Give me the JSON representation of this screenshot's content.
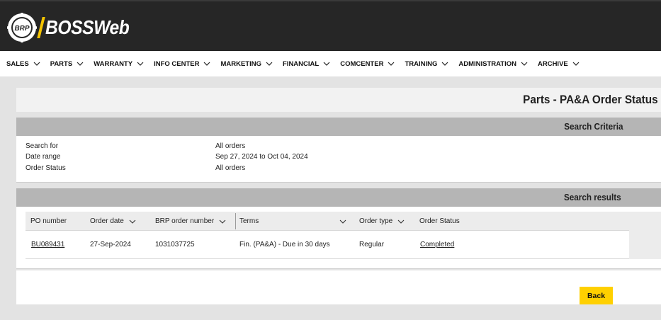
{
  "brand": {
    "brp_logo_text": "BRP",
    "app_name": "BOSSWeb",
    "accent": "#ffd000"
  },
  "nav": {
    "items": [
      {
        "label": "SALES"
      },
      {
        "label": "PARTS"
      },
      {
        "label": "WARRANTY"
      },
      {
        "label": "INFO CENTER"
      },
      {
        "label": "MARKETING"
      },
      {
        "label": "FINANCIAL"
      },
      {
        "label": "COMCENTER"
      },
      {
        "label": "TRAINING"
      },
      {
        "label": "ADMINISTRATION"
      },
      {
        "label": "ARCHIVE"
      }
    ],
    "chevron_icon": "chevron-down-icon"
  },
  "page": {
    "title": "Parts - PA&A Order Status"
  },
  "criteria": {
    "heading": "Search Criteria",
    "rows": [
      {
        "label": "Search for",
        "value": "All orders"
      },
      {
        "label": "Date range",
        "value": "Sep 27, 2024 to Oct 04, 2024"
      },
      {
        "label": "Order Status",
        "value": "All orders"
      }
    ]
  },
  "results": {
    "heading": "Search results",
    "columns": [
      {
        "label": "PO number",
        "sortable": false
      },
      {
        "label": "Order date",
        "sortable": true
      },
      {
        "label": "BRP order number",
        "sortable": true
      },
      {
        "label": "Terms",
        "sortable": true
      },
      {
        "label": "Order type",
        "sortable": true
      },
      {
        "label": "Order Status",
        "sortable": false
      }
    ],
    "rows": [
      {
        "po_number": "BU089431",
        "order_date": "27-Sep-2024",
        "brp_order_number": "1031037725",
        "terms": "Fin. (PA&A) - Due in 30 days",
        "order_type": "Regular",
        "order_status": "Completed"
      }
    ]
  },
  "actions": {
    "back_label": "Back"
  }
}
